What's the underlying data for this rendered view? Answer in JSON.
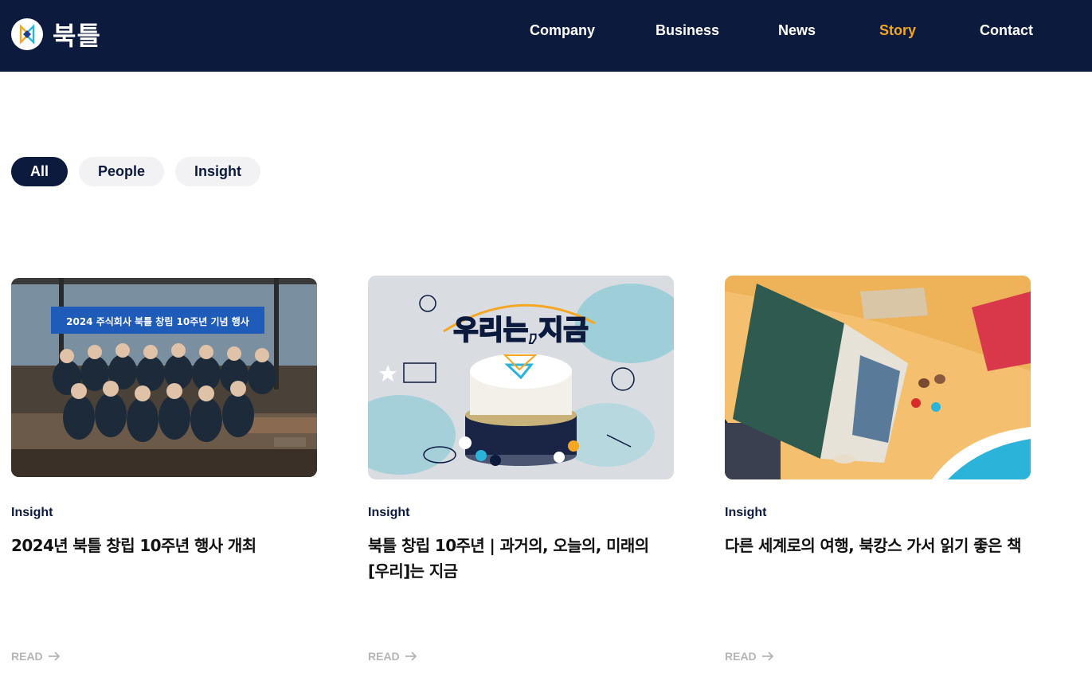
{
  "header": {
    "logo_text": "북틀",
    "nav": [
      {
        "label": "Company",
        "active": false
      },
      {
        "label": "Business",
        "active": false
      },
      {
        "label": "News",
        "active": false
      },
      {
        "label": "Story",
        "active": true
      },
      {
        "label": "Contact",
        "active": false
      }
    ]
  },
  "filters": [
    {
      "label": "All",
      "active": true
    },
    {
      "label": "People",
      "active": false
    },
    {
      "label": "Insight",
      "active": false
    }
  ],
  "cards": [
    {
      "category": "Insight",
      "title": "2024년 북틀 창립 10주년 행사 개최",
      "read_label": "READ",
      "image_banner_text": "2024 주식회사 북틀 창립 10주년 기념 행사"
    },
    {
      "category": "Insight",
      "title": "북틀 창립 10주년 | 과거의, 오늘의, 미래의 [우리]는 지금",
      "read_label": "READ",
      "image_headline_text": "우리는,지금"
    },
    {
      "category": "Insight",
      "title": "다른 세계로의 여행, 북캉스 가서 읽기 좋은 책",
      "read_label": "READ"
    }
  ],
  "colors": {
    "navy": "#0c1a3d",
    "accent": "#f5a623",
    "pill_bg": "#f2f2f4",
    "read_gray": "#b5b5b5"
  },
  "icons": {
    "logo": "bookteul-logo-icon",
    "read_arrow": "arrow-right-icon"
  }
}
